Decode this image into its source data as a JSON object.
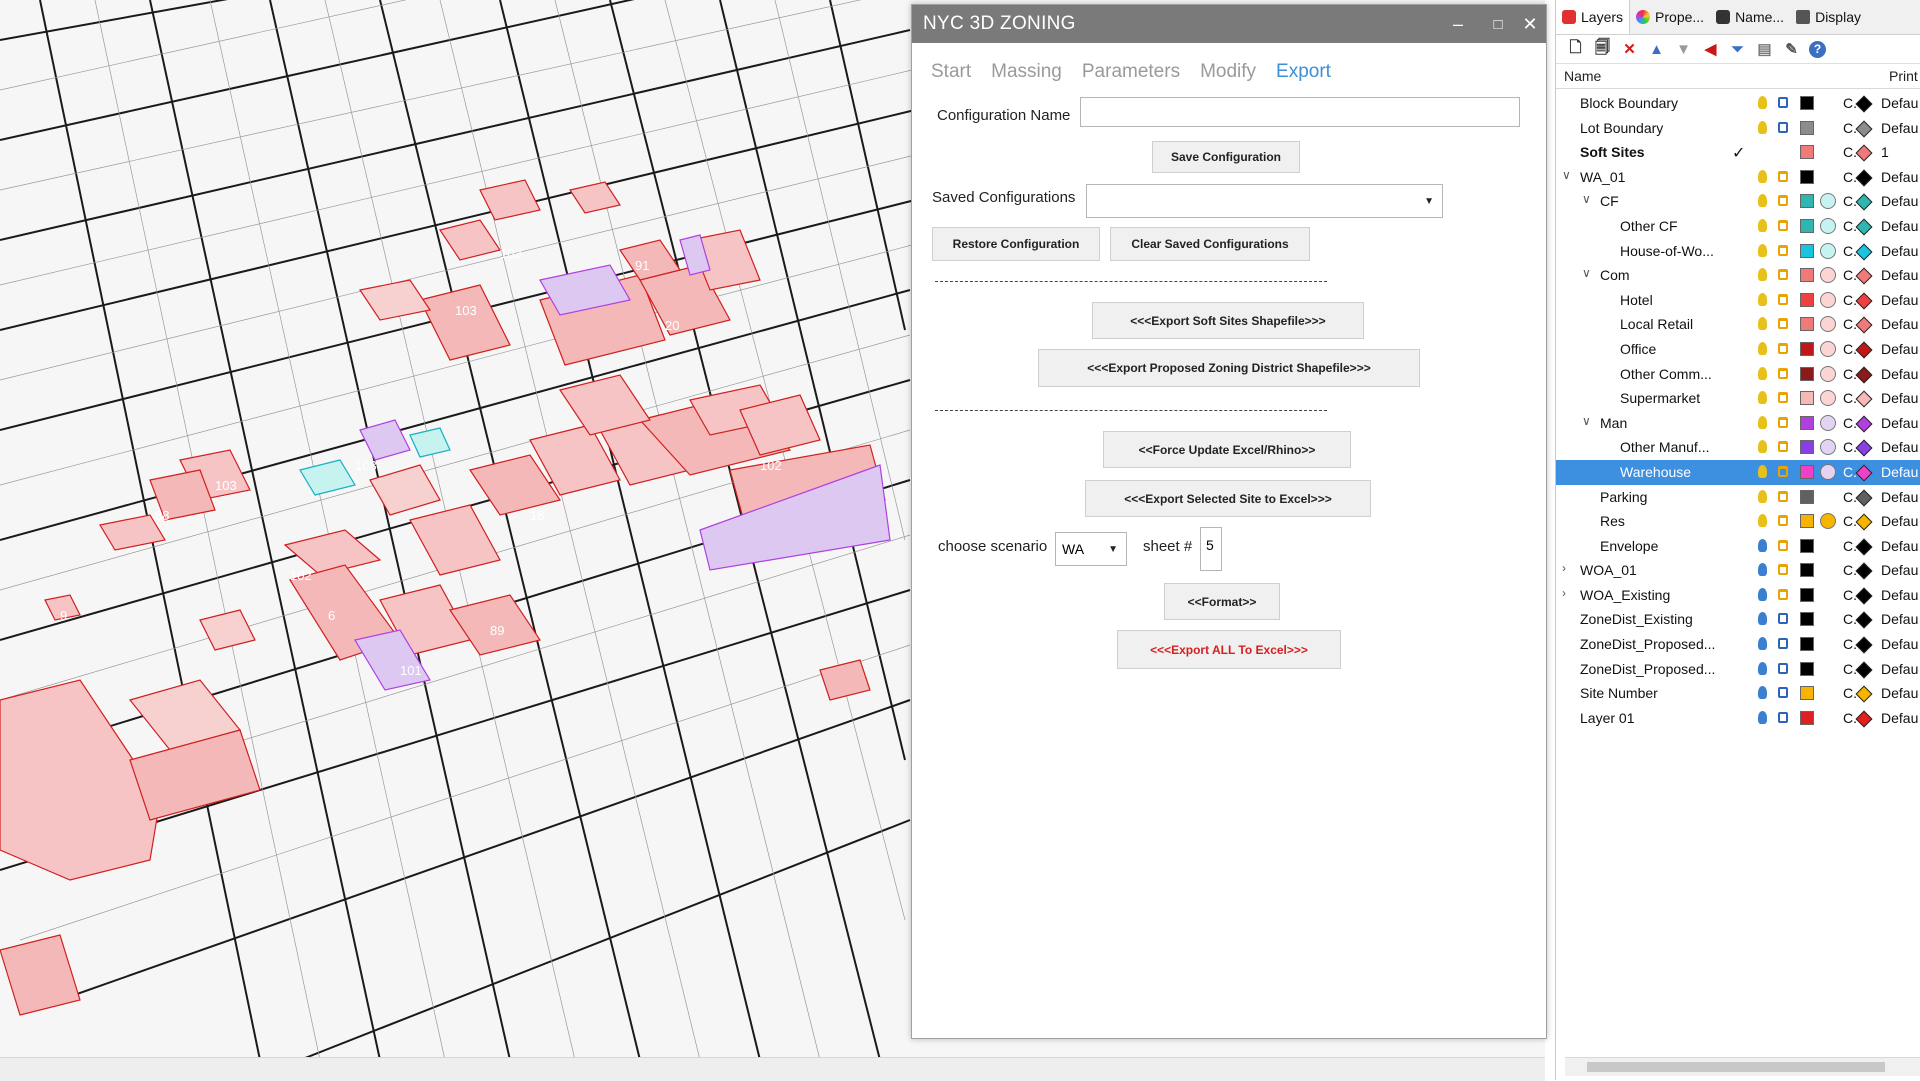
{
  "dialog": {
    "title": "NYC 3D ZONING",
    "window_controls": {
      "minimize": "‒",
      "maximize": "□",
      "close": "✕"
    },
    "tabs": [
      {
        "label": "Start",
        "active": false
      },
      {
        "label": "Massing",
        "active": false
      },
      {
        "label": "Parameters",
        "active": false
      },
      {
        "label": "Modify",
        "active": false
      },
      {
        "label": "Export",
        "active": true
      }
    ],
    "config_name_label": "Configuration Name",
    "config_name_value": "",
    "save_config_label": "Save Configuration",
    "saved_configs_label": "Saved Configurations",
    "saved_configs_value": "",
    "restore_config_label": "Restore Configuration",
    "clear_configs_label": "Clear Saved Configurations",
    "export_soft_sites_label": "<<<Export Soft Sites Shapefile>>>",
    "export_zoning_district_label": "<<<Export Proposed Zoning District Shapefile>>>",
    "force_update_label": "<<Force Update Excel/Rhino>>",
    "export_selected_label": "<<<Export Selected Site to Excel>>>",
    "scenario_label": "choose scenario",
    "scenario_value": "WA",
    "sheet_label": "sheet #",
    "sheet_value": "5",
    "format_label": "<<Format>>",
    "export_all_label": "<<<Export ALL To Excel>>>",
    "export_all_color": "#d62020"
  },
  "layers_panel": {
    "tabs": [
      {
        "label": "Layers",
        "icon": "layers-icon",
        "active": true
      },
      {
        "label": "Prope...",
        "icon": "properties-icon",
        "active": false
      },
      {
        "label": "Name...",
        "icon": "camera-icon",
        "active": false
      },
      {
        "label": "Display",
        "icon": "display-icon",
        "active": false
      }
    ],
    "column_name": "Name",
    "column_print": "Print",
    "rows": [
      {
        "name": "Block Boundary",
        "indent": 0,
        "tw": "",
        "bold": false,
        "current": "",
        "bulb": "#e8c01a",
        "lock": true,
        "color": "#000000",
        "material": "",
        "linetype": "C.",
        "pcolor": "#000000",
        "pw": "Defau",
        "selected": false
      },
      {
        "name": "Lot Boundary",
        "indent": 0,
        "tw": "",
        "bold": false,
        "current": "",
        "bulb": "#e8c01a",
        "lock": true,
        "color": "#8c8c8c",
        "material": "",
        "linetype": "C.",
        "pcolor": "#8c8c8c",
        "pw": "Defau",
        "selected": false
      },
      {
        "name": "Soft Sites",
        "indent": 0,
        "tw": "",
        "bold": true,
        "current": "✓",
        "bulb": "",
        "lock": false,
        "color": "#f07a7a",
        "material": "",
        "linetype": "C.",
        "pcolor": "#f07a7a",
        "pw": "1",
        "selected": false
      },
      {
        "name": "WA_01",
        "indent": 0,
        "tw": "∨",
        "bold": false,
        "current": "",
        "bulb": "#e8c01a",
        "lock": false,
        "color": "#000000",
        "material": "",
        "linetype": "C.",
        "pcolor": "#000000",
        "pw": "Defau",
        "selected": false
      },
      {
        "name": "CF",
        "indent": 1,
        "tw": "∨",
        "bold": false,
        "current": "",
        "bulb": "#e8c01a",
        "lock": false,
        "color": "#2fb6b0",
        "material": "#c6f2f0",
        "linetype": "C.",
        "pcolor": "#2fb6b0",
        "pw": "Defau",
        "selected": false
      },
      {
        "name": "Other CF",
        "indent": 2,
        "tw": "",
        "bold": false,
        "current": "",
        "bulb": "#e8c01a",
        "lock": false,
        "color": "#2fb6b0",
        "material": "#c6f2f0",
        "linetype": "C.",
        "pcolor": "#2fb6b0",
        "pw": "Defau",
        "selected": false
      },
      {
        "name": "House-of-Wo...",
        "indent": 2,
        "tw": "",
        "bold": false,
        "current": "",
        "bulb": "#e8c01a",
        "lock": false,
        "color": "#18c4e0",
        "material": "#c6f2f0",
        "linetype": "C.",
        "pcolor": "#18c4e0",
        "pw": "Defau",
        "selected": false
      },
      {
        "name": "Com",
        "indent": 1,
        "tw": "∨",
        "bold": false,
        "current": "",
        "bulb": "#e8c01a",
        "lock": false,
        "color": "#f07a7a",
        "material": "#fbd4d4",
        "linetype": "C.",
        "pcolor": "#f07a7a",
        "pw": "Defau",
        "selected": false
      },
      {
        "name": "Hotel",
        "indent": 2,
        "tw": "",
        "bold": false,
        "current": "",
        "bulb": "#e8c01a",
        "lock": false,
        "color": "#f04040",
        "material": "#fbd4d4",
        "linetype": "C.",
        "pcolor": "#f04040",
        "pw": "Defau",
        "selected": false
      },
      {
        "name": "Local Retail",
        "indent": 2,
        "tw": "",
        "bold": false,
        "current": "",
        "bulb": "#e8c01a",
        "lock": false,
        "color": "#f07a7a",
        "material": "#fbd4d4",
        "linetype": "C.",
        "pcolor": "#f07a7a",
        "pw": "Defau",
        "selected": false
      },
      {
        "name": "Office",
        "indent": 2,
        "tw": "",
        "bold": false,
        "current": "",
        "bulb": "#e8c01a",
        "lock": false,
        "color": "#c01818",
        "material": "#fbd4d4",
        "linetype": "C.",
        "pcolor": "#c01818",
        "pw": "Defau",
        "selected": false
      },
      {
        "name": "Other Comm...",
        "indent": 2,
        "tw": "",
        "bold": false,
        "current": "",
        "bulb": "#e8c01a",
        "lock": false,
        "color": "#8c1a1a",
        "material": "#fbd4d4",
        "linetype": "C.",
        "pcolor": "#8c1a1a",
        "pw": "Defau",
        "selected": false
      },
      {
        "name": "Supermarket",
        "indent": 2,
        "tw": "",
        "bold": false,
        "current": "",
        "bulb": "#e8c01a",
        "lock": false,
        "color": "#f7b8b8",
        "material": "#fbd4d4",
        "linetype": "C.",
        "pcolor": "#f7b8b8",
        "pw": "Defau",
        "selected": false
      },
      {
        "name": "Man",
        "indent": 1,
        "tw": "∨",
        "bold": false,
        "current": "",
        "bulb": "#e8c01a",
        "lock": false,
        "color": "#b040e0",
        "material": "#e4d4f4",
        "linetype": "C.",
        "pcolor": "#b040e0",
        "pw": "Defau",
        "selected": false
      },
      {
        "name": "Other Manuf...",
        "indent": 2,
        "tw": "",
        "bold": false,
        "current": "",
        "bulb": "#e8c01a",
        "lock": false,
        "color": "#8a40e0",
        "material": "#e4d4f4",
        "linetype": "C.",
        "pcolor": "#8a40e0",
        "pw": "Defau",
        "selected": false
      },
      {
        "name": "Warehouse",
        "indent": 2,
        "tw": "",
        "bold": false,
        "current": "",
        "bulb": "#e8c01a",
        "lock": false,
        "color": "#f040c8",
        "material": "#e4d4f4",
        "linetype": "C.",
        "pcolor": "#f040c8",
        "pw": "Defau",
        "selected": true
      },
      {
        "name": "Parking",
        "indent": 1,
        "tw": "",
        "bold": false,
        "current": "",
        "bulb": "#e8c01a",
        "lock": false,
        "color": "#606060",
        "material": "",
        "linetype": "C.",
        "pcolor": "#606060",
        "pw": "Defau",
        "selected": false
      },
      {
        "name": "Res",
        "indent": 1,
        "tw": "",
        "bold": false,
        "current": "",
        "bulb": "#e8c01a",
        "lock": false,
        "color": "#f4b400",
        "material": "#f4b400",
        "linetype": "C.",
        "pcolor": "#f4b400",
        "pw": "Defau",
        "selected": false
      },
      {
        "name": "Envelope",
        "indent": 1,
        "tw": "",
        "bold": false,
        "current": "",
        "bulb": "#3a7fd0",
        "lock": false,
        "color": "#000000",
        "material": "",
        "linetype": "C.",
        "pcolor": "#000000",
        "pw": "Defau",
        "selected": false
      },
      {
        "name": "WOA_01",
        "indent": 0,
        "tw": "›",
        "bold": false,
        "current": "",
        "bulb": "#3a7fd0",
        "lock": false,
        "color": "#000000",
        "material": "",
        "linetype": "C.",
        "pcolor": "#000000",
        "pw": "Defau",
        "selected": false
      },
      {
        "name": "WOA_Existing",
        "indent": 0,
        "tw": "›",
        "bold": false,
        "current": "",
        "bulb": "#3a7fd0",
        "lock": false,
        "color": "#000000",
        "material": "",
        "linetype": "C.",
        "pcolor": "#000000",
        "pw": "Defau",
        "selected": false
      },
      {
        "name": "ZoneDist_Existing",
        "indent": 0,
        "tw": "",
        "bold": false,
        "current": "",
        "bulb": "#3a7fd0",
        "lock": true,
        "color": "#000000",
        "material": "",
        "linetype": "C.",
        "pcolor": "#000000",
        "pw": "Defau",
        "selected": false
      },
      {
        "name": "ZoneDist_Proposed...",
        "indent": 0,
        "tw": "",
        "bold": false,
        "current": "",
        "bulb": "#3a7fd0",
        "lock": true,
        "color": "#000000",
        "material": "",
        "linetype": "C.",
        "pcolor": "#000000",
        "pw": "Defau",
        "selected": false
      },
      {
        "name": "ZoneDist_Proposed...",
        "indent": 0,
        "tw": "",
        "bold": false,
        "current": "",
        "bulb": "#3a7fd0",
        "lock": true,
        "color": "#000000",
        "material": "",
        "linetype": "C.",
        "pcolor": "#000000",
        "pw": "Defau",
        "selected": false
      },
      {
        "name": "Site Number",
        "indent": 0,
        "tw": "",
        "bold": false,
        "current": "",
        "bulb": "#3a7fd0",
        "lock": true,
        "color": "#f4b400",
        "material": "",
        "linetype": "C.",
        "pcolor": "#f4b400",
        "pw": "Defau",
        "selected": false
      },
      {
        "name": "Layer 01",
        "indent": 0,
        "tw": "",
        "bold": false,
        "current": "",
        "bulb": "#3a7fd0",
        "lock": true,
        "color": "#e02020",
        "material": "",
        "linetype": "C.",
        "pcolor": "#e02020",
        "pw": "Defau",
        "selected": false
      }
    ]
  },
  "viewport": {
    "site_labels": [
      "103",
      "103",
      "103",
      "103",
      "88",
      "102",
      "6",
      "101",
      "89",
      "102",
      "18",
      "20",
      "91",
      "9"
    ]
  }
}
